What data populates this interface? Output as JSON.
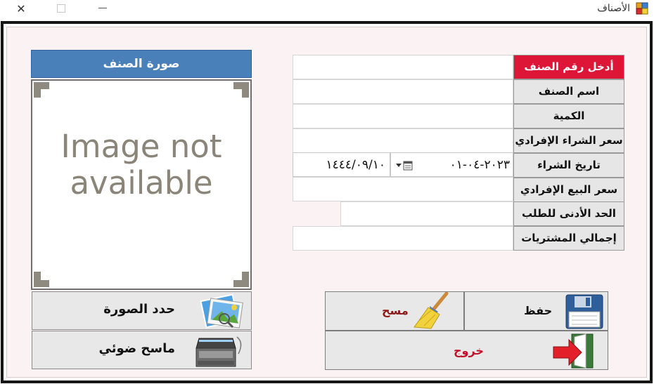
{
  "window": {
    "title": "الأصناف",
    "close_glyph": "✕"
  },
  "image_panel": {
    "header": "صورة الصنف",
    "placeholder_line1": "Image not",
    "placeholder_line2": "available",
    "select_image_label": "حدد الصورة",
    "scanner_label": "ماسح ضوئي"
  },
  "form": {
    "labels": {
      "item_number": "أدخل رقم الصنف",
      "item_name": "اسم الصنف",
      "quantity": "الكمية",
      "unit_purchase_price": "سعر الشراء الإفرادي",
      "purchase_date": "تاريخ الشراء",
      "unit_sale_price": "سعر البيع الإفرادي",
      "min_order": "الحد الأدنى للطلب",
      "total_purchases": "إجمالي المشتريات"
    },
    "values": {
      "item_number": "",
      "item_name": "",
      "quantity": "",
      "unit_purchase_price": "",
      "purchase_date_gregorian": "٢٠٢٣-٠٤-٠١",
      "purchase_date_hijri": "١٤٤٤/٠٩/١٠",
      "unit_sale_price": "",
      "min_order": "",
      "total_purchases": ""
    }
  },
  "actions": {
    "save": "حفظ",
    "clear": "مسح",
    "exit": "خروج"
  },
  "colors": {
    "accent_header": "#4a80ba",
    "first_label": "#dd1638",
    "clear_text": "#8b1a1a",
    "exit_text": "#c0102a"
  }
}
